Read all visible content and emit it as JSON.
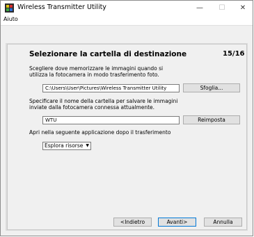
{
  "window": {
    "title": "Wireless Transmitter Utility",
    "controls": {
      "minimize": "—",
      "maximize": "☐",
      "close": "✕"
    }
  },
  "menu": {
    "items": [
      "Aiuto"
    ]
  },
  "wizard": {
    "heading": "Selezionare la cartella di destinazione",
    "step": "15/16",
    "section1": {
      "description": "Scegliere dove memorizzare le immagini quando si utilizza la fotocamera in modo trasferimento foto.",
      "path_value": "C:\\Users\\User\\Pictures\\Wireless Transmitter Utility",
      "browse_label": "Sfoglia..."
    },
    "section2": {
      "description": "Specificare il nome della cartella per salvare le immagini inviate dalla fotocamera connessa attualmente.",
      "folder_value": "WTU",
      "reset_label": "Reimposta"
    },
    "section3": {
      "label": "Apri nella seguente applicazione dopo il trasferimento",
      "selected_option": "Esplora risorse"
    },
    "footer": {
      "back_label": "<Indietro",
      "next_label": "Avanti>",
      "cancel_label": "Annulla"
    }
  },
  "colors": {
    "accent_border": "#0078d7",
    "panel_bg": "#f0f0f0"
  }
}
